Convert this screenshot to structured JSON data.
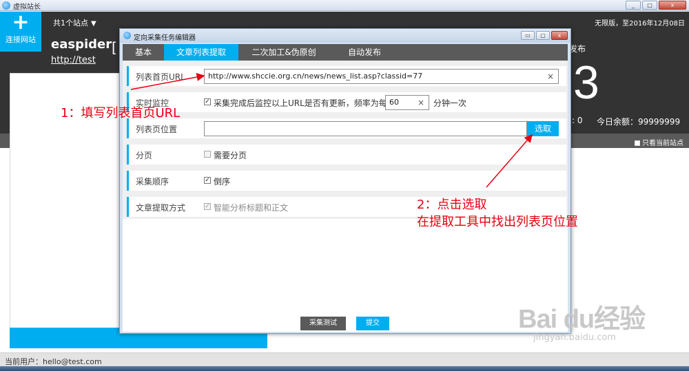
{
  "app": {
    "title": "虚拟站长",
    "window_buttons": [
      "_",
      "□",
      "x"
    ]
  },
  "header": {
    "connect_label": "连接网站",
    "connect_icon": "+",
    "site_count": "共1个站点",
    "site_count_caret": "▼",
    "edition": "无限版，至2016年12月08日",
    "site_name": "easpider",
    "site_url": "http://test",
    "site_bracket": "[",
    "publish_label": "发布",
    "big_number": "3",
    "stat_zero": ": 0",
    "balance": "今日余额：99999999"
  },
  "toolbar": {
    "only_current": "只看当前站点"
  },
  "footer": {
    "current_user": "当前用户：hello@test.com"
  },
  "dialog": {
    "title": "定向采集任务编辑器",
    "buttons": [
      "▭",
      "▢",
      "x"
    ],
    "tabs": [
      {
        "label": "基本"
      },
      {
        "label": "文章列表提取"
      },
      {
        "label": "二次加工&伪原创"
      },
      {
        "label": "自动发布"
      }
    ],
    "rows": {
      "list_url": {
        "label": "列表首页URL",
        "value": "http://www.shccie.org.cn/news/news_list.asp?classid=77",
        "clear": "×"
      },
      "monitor": {
        "label": "实时监控",
        "check": "✓",
        "text": "采集完成后监控以上URL是否有更新，频率为每",
        "interval": "60",
        "clear": "×",
        "suffix": "分钟一次"
      },
      "list_position": {
        "label": "列表页位置",
        "value": "",
        "select": "选取"
      },
      "paging": {
        "label": "分页",
        "check": "",
        "text": "需要分页"
      },
      "order": {
        "label": "采集顺序",
        "check": "✓",
        "text": "倒序"
      },
      "extract": {
        "label": "文章提取方式",
        "check": "✓",
        "text": "智能分析标题和正文"
      }
    },
    "footer": {
      "test_label": "采集测试",
      "submit_label": "提交"
    }
  },
  "annotations": {
    "step1": "1：填写列表首页URL",
    "step2_line1": "2：点击选取",
    "step2_line2": "在提取工具中找出列表页位置",
    "color": "#e60012"
  },
  "watermark": {
    "main": "Bai  du经验",
    "sub": "jingyan.baidu.com"
  },
  "colors": {
    "accent": "#00aef0",
    "header_bg": "#333333",
    "tab_bg": "#5a5a5a"
  }
}
